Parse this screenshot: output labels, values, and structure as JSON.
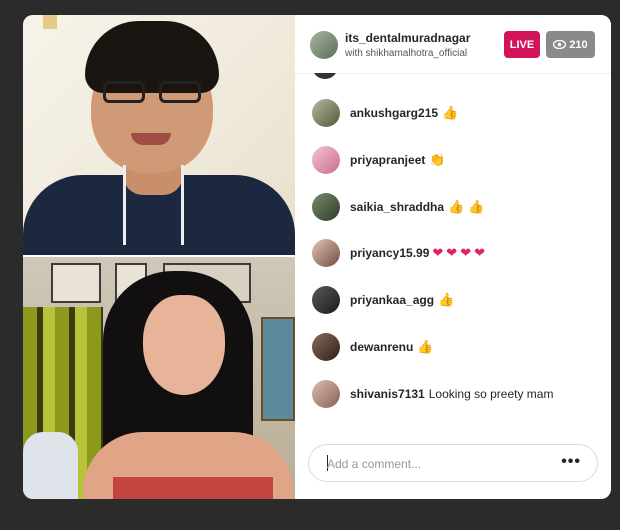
{
  "header": {
    "username": "its_dentalmuradnagar",
    "with_text": "with shikhamalhotra_official",
    "live_label": "LIVE",
    "viewer_count": "210",
    "viewer_icon": "eye-icon"
  },
  "comments": [
    {
      "user": "ankushgarg215",
      "message": "",
      "emoji": "thumbs-up",
      "count": 1
    },
    {
      "user": "priyapranjeet",
      "message": "",
      "emoji": "clap",
      "count": 1
    },
    {
      "user": "saikia_shraddha",
      "message": "",
      "emoji": "thumbs-up",
      "count": 2
    },
    {
      "user": "priyancy15.99",
      "message": "",
      "emoji": "heart",
      "count": 4
    },
    {
      "user": "priyankaa_agg",
      "message": "",
      "emoji": "thumbs-up",
      "count": 1
    },
    {
      "user": "dewanrenu",
      "message": "",
      "emoji": "thumbs-up",
      "count": 1
    },
    {
      "user": "shivanis7131",
      "message": "Looking so preety mam",
      "emoji": "",
      "count": 0
    }
  ],
  "composer": {
    "placeholder": "Add a comment...",
    "more_label": "•••"
  },
  "colors": {
    "live": "#d4145a",
    "viewer_badge": "#8a8a8a",
    "heart": "#e0245e"
  }
}
